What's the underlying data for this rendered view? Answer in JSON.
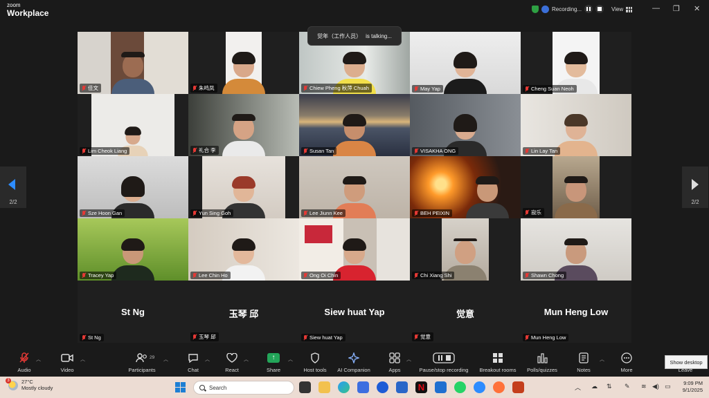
{
  "app": {
    "logo_small": "zoom",
    "logo_large": "Workplace",
    "recording_label": "Recording...",
    "view_label": "View",
    "win_min": "—",
    "win_restore": "❐",
    "win_close": "✕"
  },
  "talking": {
    "name": "觉年（工作人员）",
    "status": "is talking..."
  },
  "pager": {
    "left": "2/2",
    "right": "2/2"
  },
  "participants": [
    {
      "name": "佳文"
    },
    {
      "name": "朱鸣凤"
    },
    {
      "name": "Chiew Pheng 秋萍 Chuah"
    },
    {
      "name": "May Yap"
    },
    {
      "name": "Cheng Suan Neoh"
    },
    {
      "name": "Lim Cheok Liang"
    },
    {
      "name": "礼合 李"
    },
    {
      "name": "Susan Tan"
    },
    {
      "name": "VISAKHA ONG"
    },
    {
      "name": "Lin Lay Tan"
    },
    {
      "name": "Sze Hoon Gan"
    },
    {
      "name": "Yun Sing Goh"
    },
    {
      "name": "Lee Jiunn Kee"
    },
    {
      "name": "BEH PEIXIN"
    },
    {
      "name": "寂乐"
    },
    {
      "name": "Tracey Yap"
    },
    {
      "name": "Lee Chin Ho"
    },
    {
      "name": "Ong Oi Chin"
    },
    {
      "name": "Chi Xiang Shi"
    },
    {
      "name": "Shawn Chong"
    },
    {
      "name": "St Ng"
    },
    {
      "name": "玉琴 邱"
    },
    {
      "name": "Siew huat Yap"
    },
    {
      "name": "觉意"
    },
    {
      "name": "Mun Heng Low"
    }
  ],
  "toolbar": {
    "audio": "Audio",
    "video": "Video",
    "participants": "Participants",
    "participants_count": "29",
    "chat": "Chat",
    "react": "React",
    "share": "Share",
    "host_tools": "Host tools",
    "ai_companion": "AI Companion",
    "apps": "Apps",
    "pause_stop": "Pause/stop recording",
    "breakout": "Breakout rooms",
    "polls": "Polls/quizzes",
    "notes": "Notes",
    "more": "More",
    "leave": "Leave",
    "show_desktop": "Show desktop"
  },
  "taskbar": {
    "temp": "27°C",
    "condition": "Mostly cloudy",
    "weather_badge": "3",
    "search_placeholder": "Search",
    "time": "9:09 PM",
    "date": "9/1/2025"
  },
  "colors": {
    "accent_share": "#23a559",
    "mic_off": "#e53935",
    "taskbar_bg": "#ecdcd3"
  }
}
